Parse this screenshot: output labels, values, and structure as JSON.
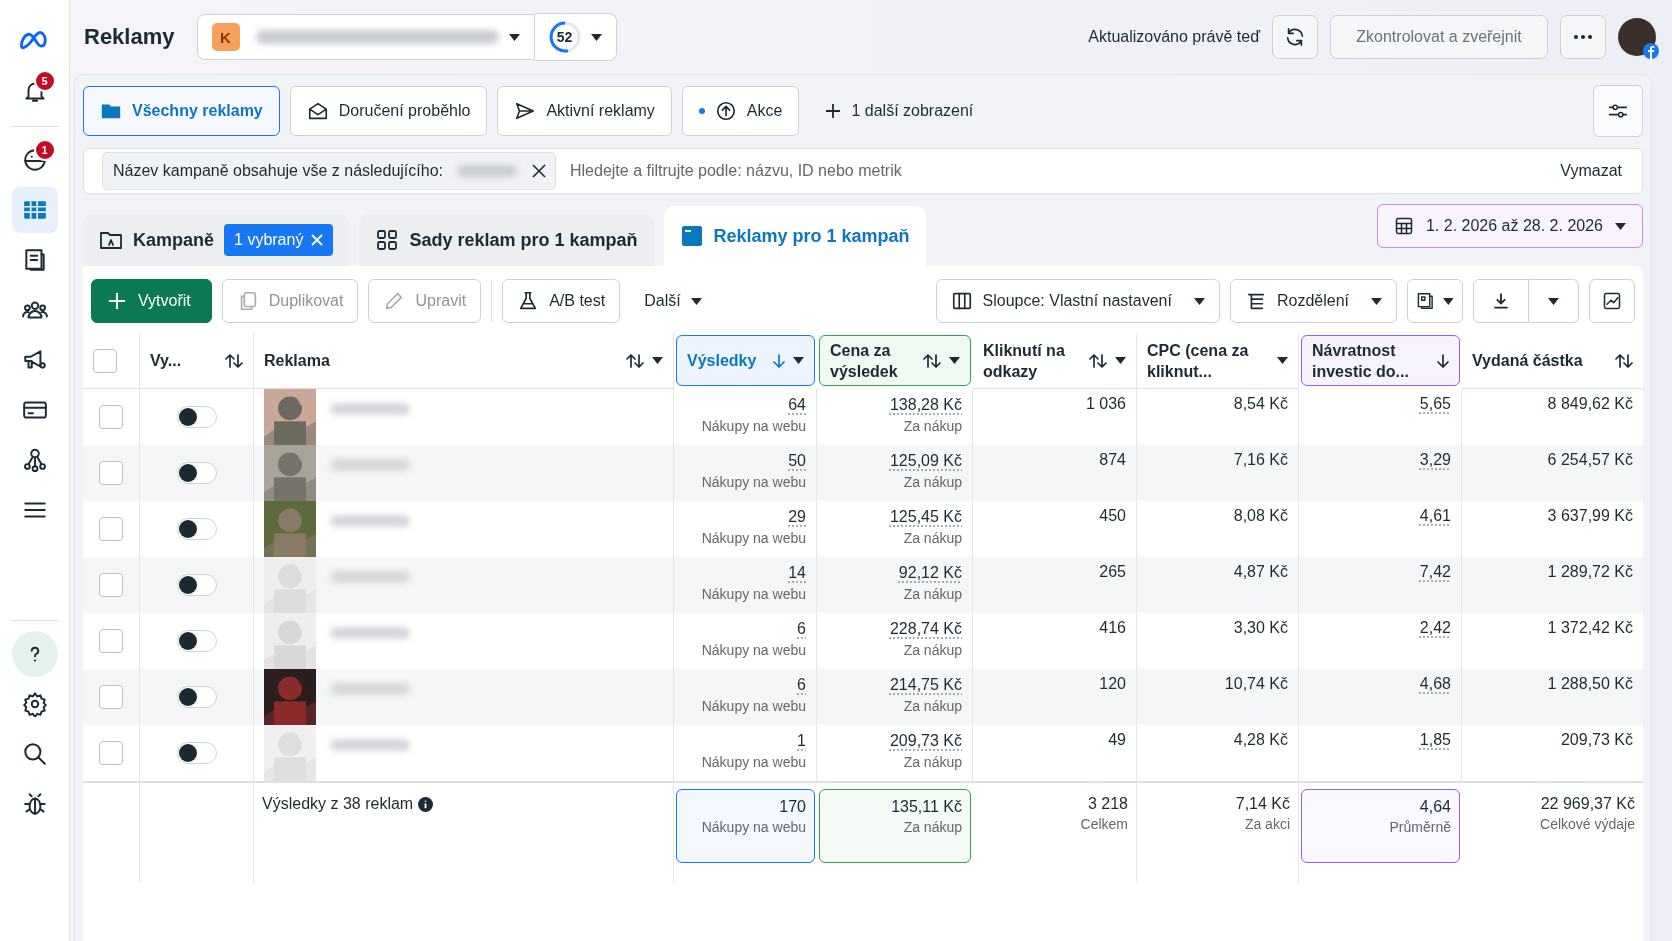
{
  "sidebar": {
    "items": [
      {
        "kind": "logo",
        "selected": false
      },
      {
        "kind": "bell",
        "selected": false,
        "badge": "5"
      },
      {
        "kind": "planet",
        "selected": false,
        "badge": "1"
      },
      {
        "kind": "table",
        "selected": true
      },
      {
        "kind": "pages",
        "selected": false
      },
      {
        "kind": "people",
        "selected": false
      },
      {
        "kind": "megaphone",
        "selected": false
      },
      {
        "kind": "card",
        "selected": false
      },
      {
        "kind": "network",
        "selected": false
      },
      {
        "kind": "menu",
        "selected": false
      }
    ],
    "bottom_items": [
      {
        "kind": "help",
        "selected": true
      },
      {
        "kind": "settings",
        "selected": false
      },
      {
        "kind": "search",
        "selected": false
      },
      {
        "kind": "bug",
        "selected": false
      }
    ]
  },
  "header": {
    "title": "Reklamy",
    "account_initial": "K",
    "score": "52",
    "updated": "Aktualizováno právě teď",
    "publish": {
      "label": "Zkontrolovat a zveřejnit",
      "disabled": true
    }
  },
  "views": [
    {
      "kind": "folder",
      "label": "Všechny reklamy",
      "selected": true,
      "dot": false
    },
    {
      "kind": "envelope",
      "label": "Doručení proběhlo",
      "selected": false,
      "dot": false
    },
    {
      "kind": "send",
      "label": "Aktivní reklamy",
      "selected": false,
      "dot": false
    },
    {
      "kind": "upload",
      "label": "Akce",
      "selected": false,
      "dot": true
    }
  ],
  "add_view": "1 další zobrazení",
  "filter": {
    "chip": "Název kampaně obsahuje vše z následujícího:",
    "placeholder": "Hledejte a filtrujte podle: názvu, ID nebo metrik",
    "clear": "Vymazat"
  },
  "level_tabs": [
    {
      "kind": "campaign",
      "label": "Kampaně",
      "badge": "1 vybraný",
      "selected": false
    },
    {
      "kind": "adset",
      "label": "Sady reklam pro 1 kampaň",
      "selected": false
    },
    {
      "kind": "ad",
      "label": "Reklamy pro 1 kampaň",
      "selected": true
    }
  ],
  "date_range": "1. 2. 2026 až 28. 2. 2026",
  "toolbar": {
    "left": [
      {
        "kind": "primary",
        "label": "Vytvořit",
        "disabled": false
      },
      {
        "kind": "duplicate",
        "label": "Duplikovat",
        "disabled": true
      },
      {
        "kind": "edit",
        "label": "Upravit",
        "disabled": true
      },
      {
        "kind": "abtest",
        "label": "A/B test",
        "disabled": false
      },
      {
        "kind": "more",
        "label": "Další",
        "disabled": false
      }
    ],
    "right": [
      {
        "kind": "columns",
        "label": "Sloupce: Vlastní nastavení"
      },
      {
        "kind": "breakdown",
        "label": "Rozdělení"
      }
    ]
  },
  "table": {
    "select_all_checked": false,
    "columns": [
      {
        "label": "Vy...",
        "sortable": true,
        "sorted": false,
        "menu": false
      },
      {
        "label": "Reklama",
        "sortable": true,
        "sorted": false,
        "menu": true
      },
      {
        "label": "Výsledky",
        "sorted": true,
        "menu": true,
        "color": "#1877f2"
      },
      {
        "label": "Cena za výsledek",
        "sortable": true,
        "sorted": false,
        "menu": true,
        "color": "#31a24c"
      },
      {
        "label": "Kliknutí na odkazy",
        "sortable": true,
        "sorted": false,
        "menu": true
      },
      {
        "label": "CPC (cena za kliknut...",
        "sortable": false,
        "sorted": false,
        "menu": true
      },
      {
        "label": "Návratnost investic do...",
        "sorted": true,
        "menu": false,
        "color": "#9360f7"
      },
      {
        "label": "Vydaná částka",
        "sortable": true,
        "sorted": false,
        "menu": false
      }
    ],
    "rows": [
      {
        "checked": false,
        "on": false,
        "results": "64",
        "results_label": "Nákupy na webu",
        "cost": "138,28 Kč",
        "cost_label": "Za nákup",
        "clicks": "1 036",
        "cpc": "8,54 Kč",
        "roas": "5,65",
        "spend": "8 849,62 Kč"
      },
      {
        "checked": false,
        "on": false,
        "results": "50",
        "results_label": "Nákupy na webu",
        "cost": "125,09 Kč",
        "cost_label": "Za nákup",
        "clicks": "874",
        "cpc": "7,16 Kč",
        "roas": "3,29",
        "spend": "6 254,57 Kč"
      },
      {
        "checked": false,
        "on": false,
        "results": "29",
        "results_label": "Nákupy na webu",
        "cost": "125,45 Kč",
        "cost_label": "Za nákup",
        "clicks": "450",
        "cpc": "8,08 Kč",
        "roas": "4,61",
        "spend": "3 637,99 Kč"
      },
      {
        "checked": false,
        "on": false,
        "results": "14",
        "results_label": "Nákupy na webu",
        "cost": "92,12 Kč",
        "cost_label": "Za nákup",
        "clicks": "265",
        "cpc": "4,87 Kč",
        "roas": "7,42",
        "spend": "1 289,72 Kč"
      },
      {
        "checked": false,
        "on": false,
        "results": "6",
        "results_label": "Nákupy na webu",
        "cost": "228,74 Kč",
        "cost_label": "Za nákup",
        "clicks": "416",
        "cpc": "3,30 Kč",
        "roas": "2,42",
        "spend": "1 372,42 Kč"
      },
      {
        "checked": false,
        "on": false,
        "results": "6",
        "results_label": "Nákupy na webu",
        "cost": "214,75 Kč",
        "cost_label": "Za nákup",
        "clicks": "120",
        "cpc": "10,74 Kč",
        "roas": "4,68",
        "spend": "1 288,50 Kč"
      },
      {
        "checked": false,
        "on": false,
        "results": "1",
        "results_label": "Nákupy na webu",
        "cost": "209,73 Kč",
        "cost_label": "Za nákup",
        "clicks": "49",
        "cpc": "4,28 Kč",
        "roas": "1,85",
        "spend": "209,73 Kč"
      }
    ],
    "summary": {
      "label": "Výsledky z 38 reklam",
      "cells": [
        {
          "value": "170",
          "label": "Nákupy na webu"
        },
        {
          "value": "135,11 Kč",
          "label": "Za nákup"
        },
        {
          "value": "3 218",
          "label": "Celkem"
        },
        {
          "value": "7,14 Kč",
          "label": "Za akci"
        },
        {
          "value": "4,64",
          "label": "Průměrně"
        },
        {
          "value": "22 969,37 Kč",
          "label": "Celkové výdaje"
        }
      ]
    }
  }
}
